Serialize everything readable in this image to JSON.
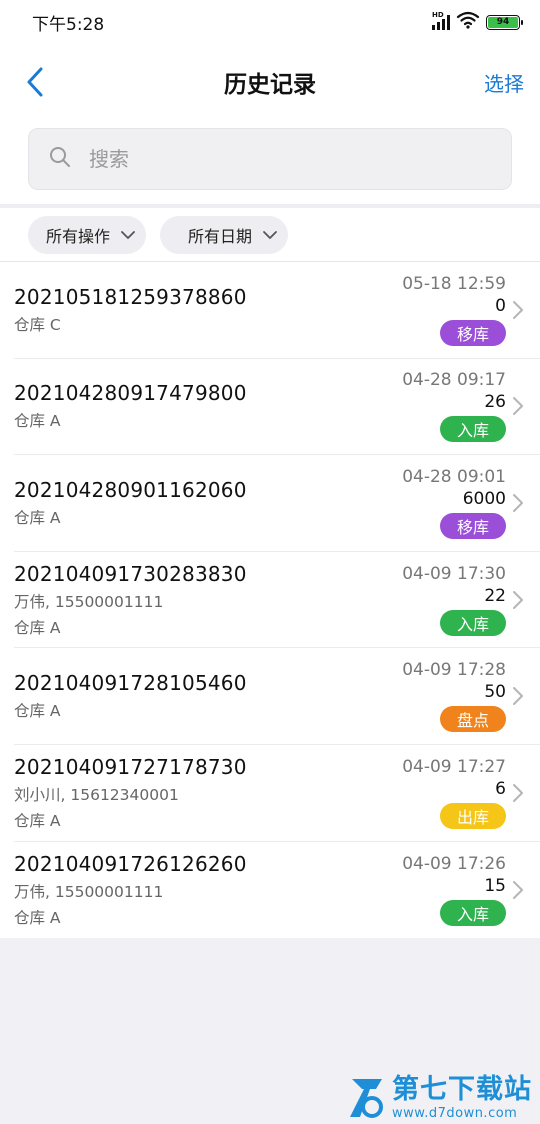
{
  "status_bar": {
    "time": "下午5:28",
    "network_label": "HD",
    "battery": "94"
  },
  "nav": {
    "title": "历史记录",
    "select_label": "选择"
  },
  "search": {
    "placeholder": "搜索"
  },
  "filters": [
    {
      "label": "所有操作"
    },
    {
      "label": "所有日期"
    }
  ],
  "badge_colors": {
    "移库": "#9b4fd8",
    "入库": "#2fb34f",
    "盘点": "#f0831c",
    "出库": "#f5c518"
  },
  "records": [
    {
      "order_no": "202105181259378860",
      "contact": "",
      "warehouse": "仓库 C",
      "time": "05-18 12:59",
      "qty": "0",
      "type": "移库"
    },
    {
      "order_no": "202104280917479800",
      "contact": "",
      "warehouse": "仓库 A",
      "time": "04-28 09:17",
      "qty": "26",
      "type": "入库"
    },
    {
      "order_no": "202104280901162060",
      "contact": "",
      "warehouse": "仓库 A",
      "time": "04-28 09:01",
      "qty": "6000",
      "type": "移库"
    },
    {
      "order_no": "202104091730283830",
      "contact": "万伟, 15500001111",
      "warehouse": "仓库 A",
      "time": "04-09 17:30",
      "qty": "22",
      "type": "入库"
    },
    {
      "order_no": "202104091728105460",
      "contact": "",
      "warehouse": "仓库 A",
      "time": "04-09 17:28",
      "qty": "50",
      "type": "盘点"
    },
    {
      "order_no": "202104091727178730",
      "contact": "刘小川, 15612340001",
      "warehouse": "仓库 A",
      "time": "04-09 17:27",
      "qty": "6",
      "type": "出库"
    },
    {
      "order_no": "202104091726126260",
      "contact": "万伟, 15500001111",
      "warehouse": "仓库 A",
      "time": "04-09 17:26",
      "qty": "15",
      "type": "入库"
    }
  ],
  "watermark": {
    "logo_letter": "7",
    "title": "第七下载站",
    "url": "www.d7down.com"
  }
}
